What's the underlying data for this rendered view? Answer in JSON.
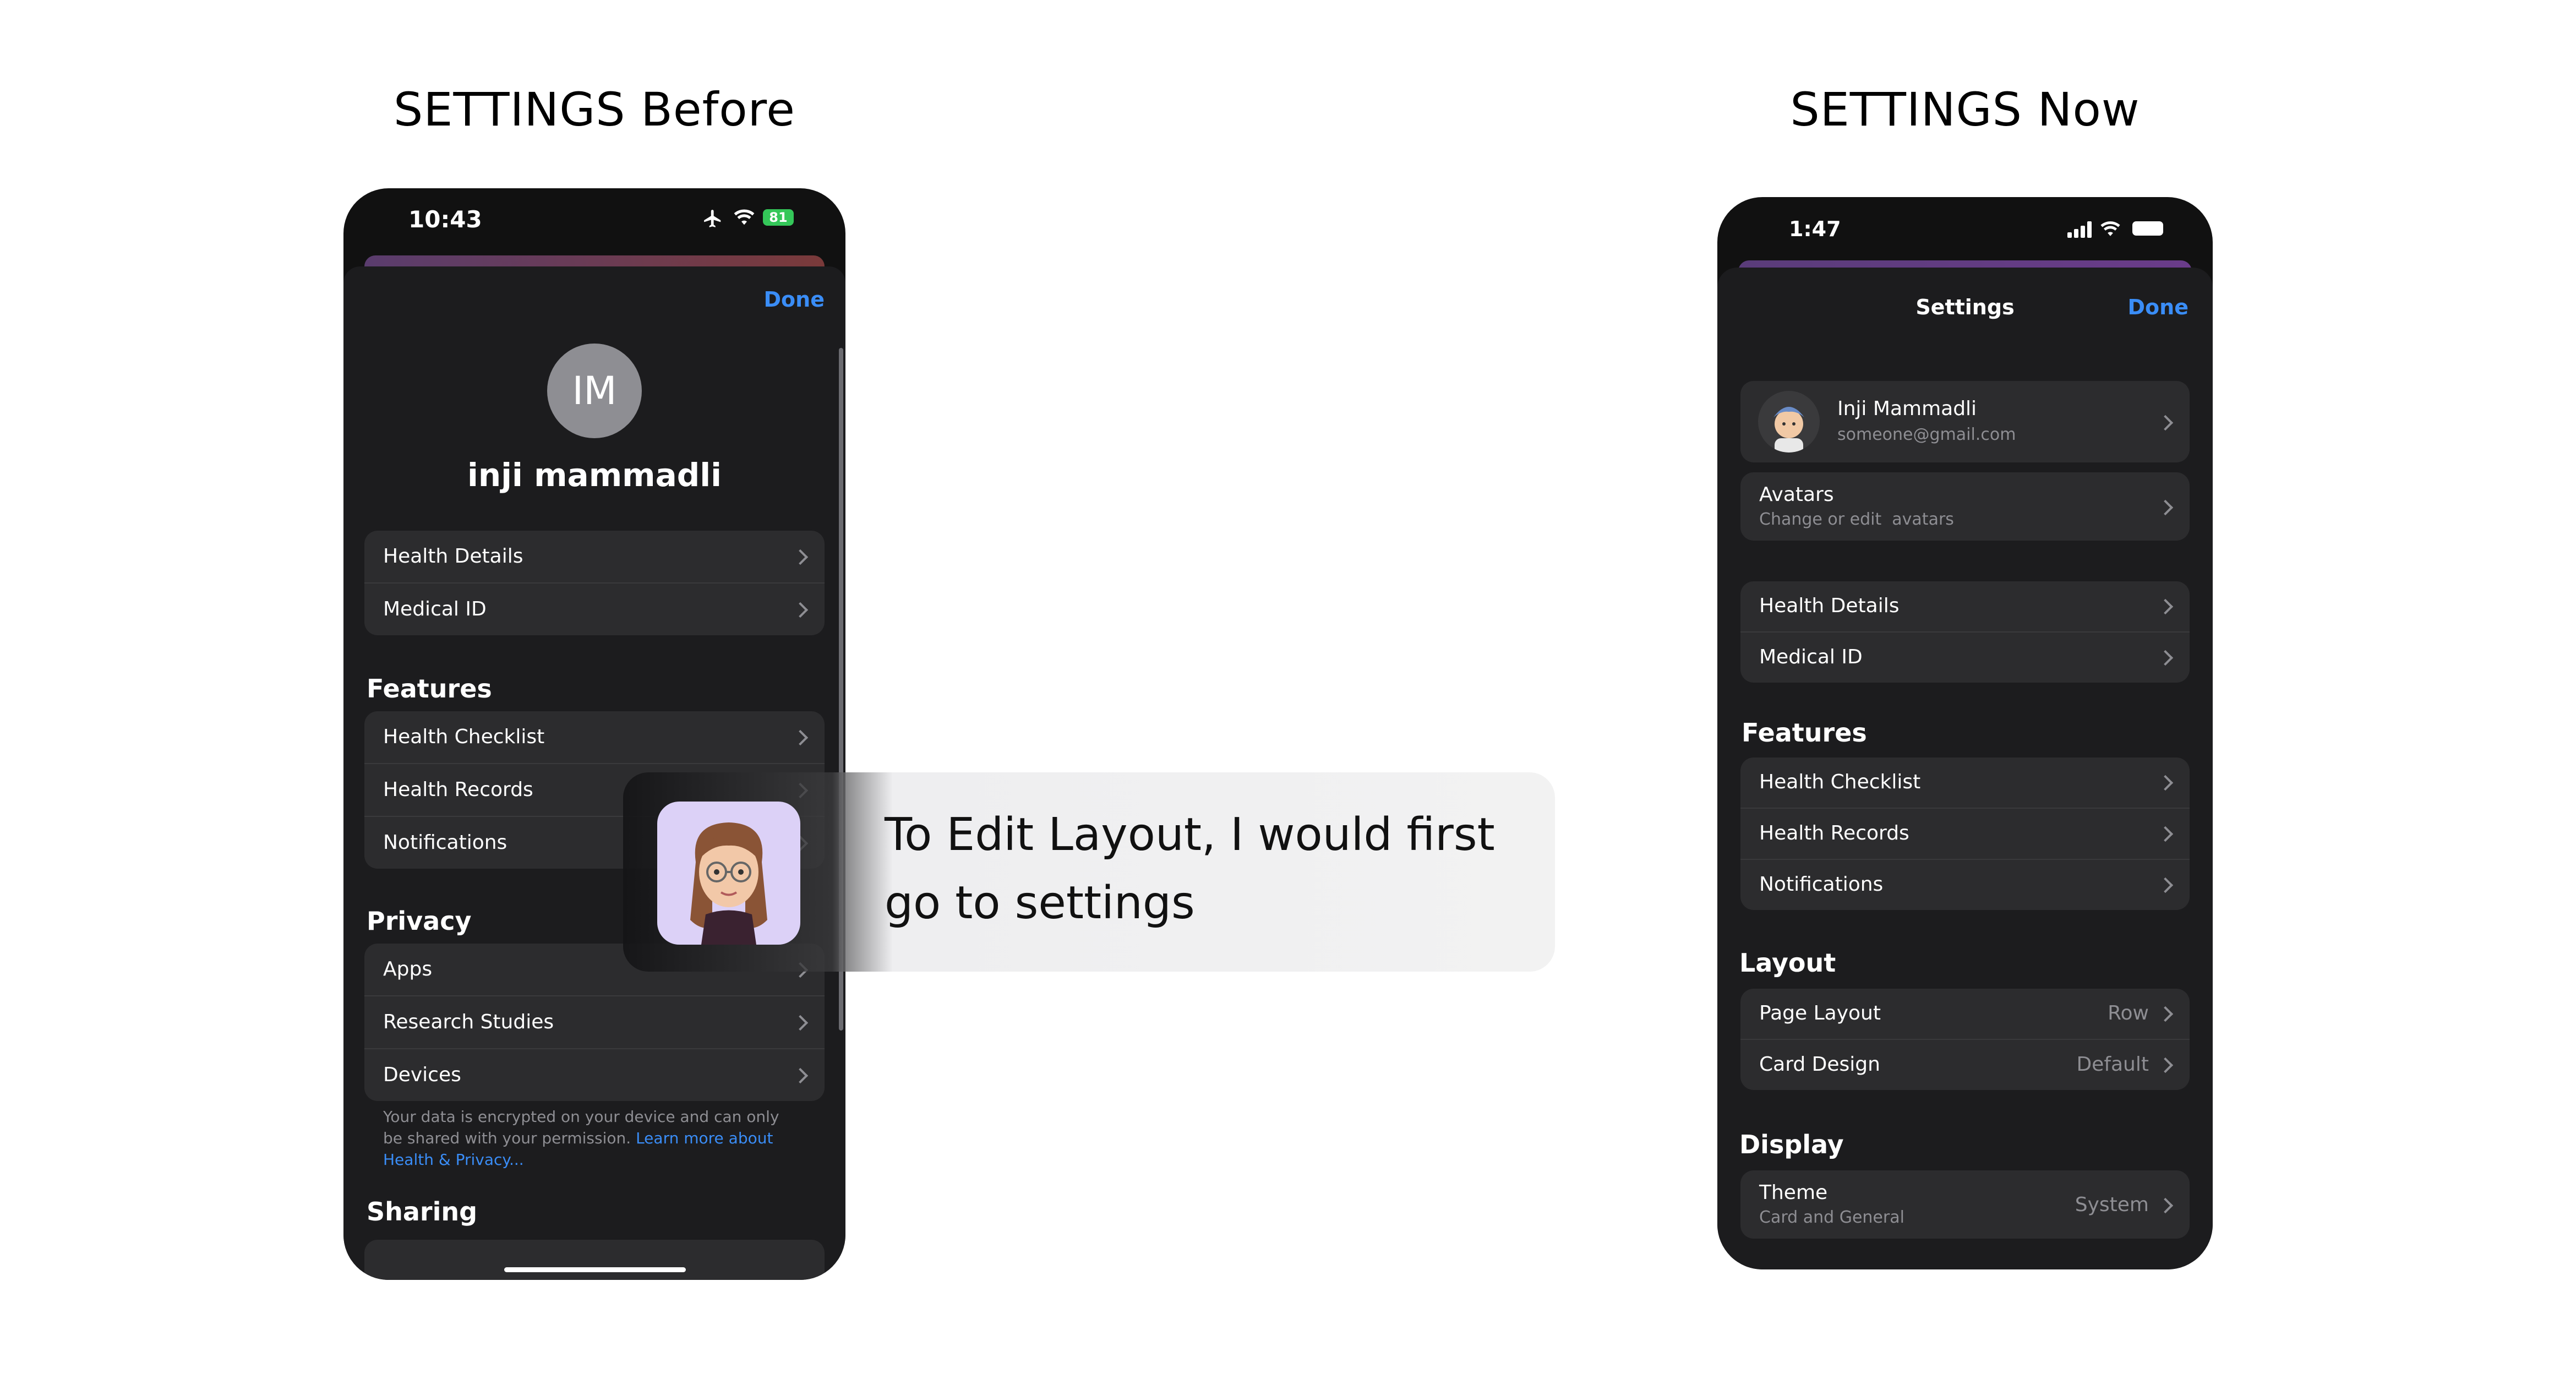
{
  "headings": {
    "before": "SETTINGS Before",
    "now": "SETTINGS Now"
  },
  "before": {
    "status_time": "10:43",
    "battery": "81",
    "done": "Done",
    "avatar_initials": "IM",
    "name": "inji mammadli",
    "health_group": [
      "Health Details",
      "Medical ID"
    ],
    "features_title": "Features",
    "features": [
      "Health Checklist",
      "Health Records",
      "Notifications"
    ],
    "privacy_title": "Privacy",
    "privacy": [
      "Apps",
      "Research Studies",
      "Devices"
    ],
    "privacy_note": "Your data is encrypted on your device and can only be shared with your permission.",
    "privacy_link": "Learn more about Health & Privacy...",
    "sharing_title": "Sharing"
  },
  "now": {
    "status_time": "1:47",
    "title": "Settings",
    "done": "Done",
    "profile": {
      "name": "Inji Mammadli",
      "email": "someone@gmail.com"
    },
    "avatars": {
      "label": "Avatars",
      "sub": "Change or edit  avatars"
    },
    "health_group": [
      "Health Details",
      "Medical ID"
    ],
    "features_title": "Features",
    "features": [
      "Health Checklist",
      "Health Records",
      "Notifications"
    ],
    "layout_title": "Layout",
    "layout": {
      "page_layout": "Page Layout",
      "page_layout_value": "Row",
      "card_design": "Card Design",
      "card_design_value": "Default"
    },
    "display_title": "Display",
    "theme": {
      "label": "Theme",
      "sub": "Card and General",
      "value": "System"
    }
  },
  "bubble": {
    "text": "To Edit Layout, I would first go to settings"
  },
  "colors": {
    "accent": "#3a8df7",
    "bg": "#1c1c1e",
    "cell": "#2c2c2e",
    "avatar_bg": "#dcd1f7",
    "battery_green": "#34c759"
  },
  "icons": [
    "airplane-icon",
    "wifi-icon",
    "battery-icon",
    "cellular-icon",
    "chevron-right-icon"
  ]
}
